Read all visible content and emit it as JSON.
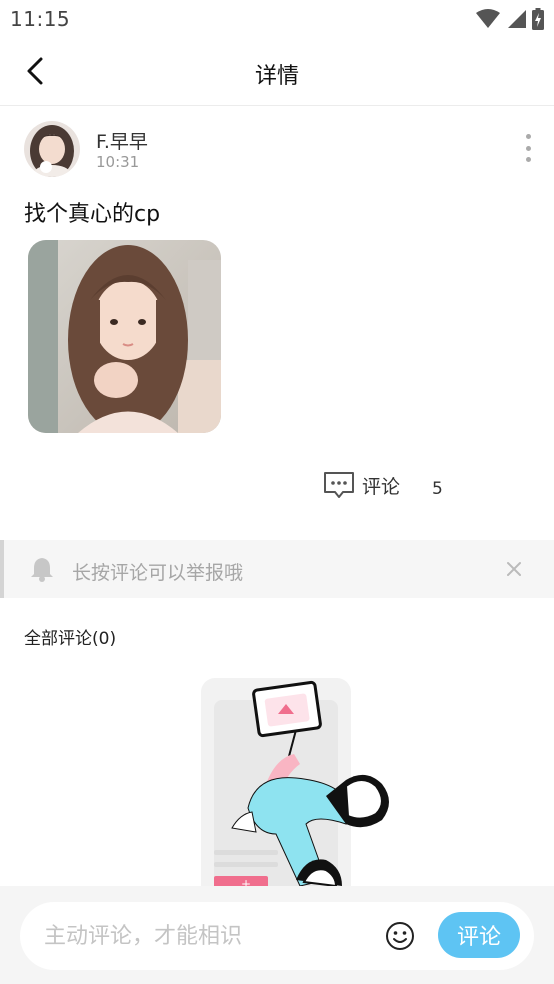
{
  "status_bar": {
    "time": "11:15",
    "icons": [
      "wifi-icon",
      "signal-icon",
      "battery-charging-icon"
    ]
  },
  "nav": {
    "title": "详情",
    "back_icon": "chevron-left-icon"
  },
  "post": {
    "author_name": "F.早早",
    "time": "10:31",
    "content": "找个真心的cp",
    "more_icon": "more-vertical-icon",
    "comment_label": "评论",
    "comment_count": "5"
  },
  "notice": {
    "text": "长按评论可以举报哦",
    "icon": "bell-icon",
    "close_icon": "close-icon"
  },
  "comments": {
    "header": "全部评论(0)"
  },
  "bottom_bar": {
    "placeholder": "主动评论，才能相识",
    "emoji_icon": "smiley-icon",
    "submit_label": "评论"
  },
  "colors": {
    "accent": "#5ec4f3",
    "divider": "#ececec",
    "notice_bg": "#f6f6f6"
  }
}
